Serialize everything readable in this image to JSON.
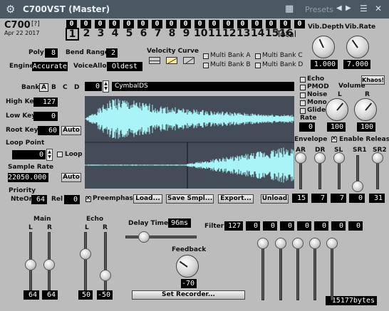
{
  "window": {
    "title": "C700VST (Master)",
    "presets_label": "Presets"
  },
  "header": {
    "logo": "C700",
    "help": "[?]",
    "date": "Apr 22 2017",
    "seq_values": [
      "0",
      "0",
      "0",
      "0",
      "0",
      "0",
      "0",
      "0",
      "0",
      "0",
      "0",
      "0",
      "0",
      "0",
      "0",
      "0",
      "0"
    ],
    "channels": [
      "1",
      "2",
      "3",
      "4",
      "5",
      "6",
      "7",
      "8",
      "9",
      "10",
      "11",
      "12",
      "13",
      "14",
      "15",
      "16"
    ],
    "total_label": "Total"
  },
  "vib": {
    "depth_label": "Vib.Depth",
    "rate_label": "Vib.Rate",
    "depth_value": "1.000",
    "rate_value": "7.000"
  },
  "params": {
    "poly_label": "Poly",
    "poly_value": "8",
    "bend_label": "Bend Range",
    "bend_value": "2",
    "engine_label": "Engine",
    "engine_value": "Accurate",
    "voicealloc_label": "VoiceAlloc",
    "voicealloc_value": "Oldest",
    "velocity_label": "Velocity Curve"
  },
  "multibank": [
    "Multi Bank A",
    "Multi Bank B",
    "Multi Bank C",
    "Multi Bank D"
  ],
  "bank": {
    "label": "Bank",
    "options": [
      "A",
      "B",
      "C",
      "D"
    ],
    "program": "0",
    "sample_name": "CymbalDS"
  },
  "left": {
    "highkey_label": "High Key",
    "highkey_value": "127",
    "lowkey_label": "Low Key",
    "lowkey_value": "0",
    "rootkey_label": "Root Key",
    "rootkey_value": "60",
    "auto": "Auto",
    "looppoint_label": "Loop Point",
    "looppoint_value": "0",
    "loop_label": "Loop",
    "samplerate_label": "Sample Rate",
    "samplerate_value": "22050.000",
    "priority_label": "Priority",
    "nteon_label": "NteOn",
    "nteon_value": "64",
    "rel_label": "Rel",
    "rel_value": "0"
  },
  "buttons": {
    "preemphasis": "Preemphasis",
    "load": "Load...",
    "save": "Save Smpl...",
    "export": "Export...",
    "unload": "Unload",
    "set_recorder": "Set Recorder..."
  },
  "options": {
    "items": [
      "Echo",
      "PMOD",
      "Noise",
      "Mono",
      "Glide"
    ],
    "rate_label": "Rate",
    "rate_value": "0",
    "khaos": "Khaos!"
  },
  "volume": {
    "label": "Volume",
    "l": "L",
    "r": "R",
    "l_value": "100",
    "r_value": "100"
  },
  "envelope": {
    "label": "Envelope",
    "enable_release": "Enable Release",
    "cols": [
      "AR",
      "DR",
      "SL",
      "SR1",
      "SR2"
    ],
    "values": [
      "15",
      "7",
      "7",
      "0",
      "31"
    ],
    "levels": [
      1.0,
      1.0,
      1.0,
      0.0,
      1.0
    ]
  },
  "main": {
    "label": "Main",
    "l": "L",
    "r": "R",
    "l_value": "64",
    "r_value": "64",
    "l_level": 0.5,
    "r_level": 0.5
  },
  "echo": {
    "label": "Echo",
    "l": "L",
    "r": "R",
    "l_value": "50",
    "r_value": "-50",
    "l_level": 0.7,
    "r_level": 0.3
  },
  "delay": {
    "label": "Delay Time",
    "value": "96ms",
    "level": 0.2
  },
  "feedback": {
    "label": "Feedback",
    "value": "-70"
  },
  "filter": {
    "label": "Filter",
    "values": [
      "127",
      "0",
      "0",
      "0",
      "0",
      "0",
      "0",
      "0"
    ]
  },
  "status": {
    "bytes": "15177bytes"
  },
  "colors": {
    "accent": "#000000",
    "wave": "#a8f4f6",
    "wave_bg": "#444c59"
  }
}
